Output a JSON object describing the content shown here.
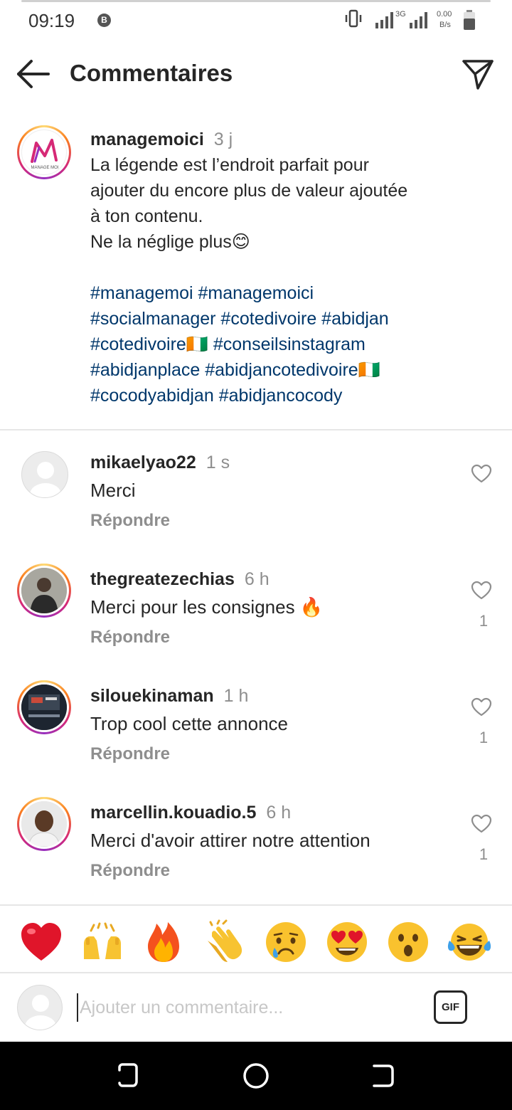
{
  "status_bar": {
    "time": "09:19",
    "notification_badge": "B",
    "network_type": "3G",
    "speed_value": "0.00",
    "speed_unit": "B/s"
  },
  "header": {
    "title": "Commentaires"
  },
  "caption": {
    "username": "managemoici",
    "time": "3 j",
    "lines": [
      "La légende est l’endroit parfait pour",
      "ajouter du encore plus de valeur ajoutée",
      "à ton contenu.",
      "Ne la néglige plus😊"
    ],
    "hashtag_lines": [
      "#managemoi #managemoici",
      "#socialmanager #cotedivoire #abidjan",
      "#cotedivoire🇨🇮 #conseilsinstagram",
      "#abidjanplace #abidjancotedivoire🇨🇮",
      "#cocodyabidjan #abidjancocody"
    ],
    "avatar_text": "MANAGE MOI"
  },
  "comments": [
    {
      "username": "mikaelyao22",
      "time": "1 s",
      "text": "Merci",
      "reply_label": "Répondre",
      "likes": ""
    },
    {
      "username": "thegreatezechias",
      "time": "6 h",
      "text": "Merci pour les consignes 🔥",
      "reply_label": "Répondre",
      "likes": "1"
    },
    {
      "username": "silouekinaman",
      "time": "1 h",
      "text": "Trop cool cette annonce",
      "reply_label": "Répondre",
      "likes": "1"
    },
    {
      "username": "marcellin.kouadio.5",
      "time": "6 h",
      "text": "Merci d'avoir attirer notre attention",
      "reply_label": "Répondre",
      "likes": "1"
    }
  ],
  "emoji_bar": [
    "❤️",
    "🙌",
    "🔥",
    "👏",
    "😢",
    "😍",
    "😮",
    "😂"
  ],
  "input": {
    "placeholder": "Ajouter un commentaire...",
    "value": "",
    "gif_label": "GIF"
  },
  "colors": {
    "hashtag": "#00376b",
    "secondary_text": "#8e8e8e",
    "primary_text": "#262626"
  }
}
